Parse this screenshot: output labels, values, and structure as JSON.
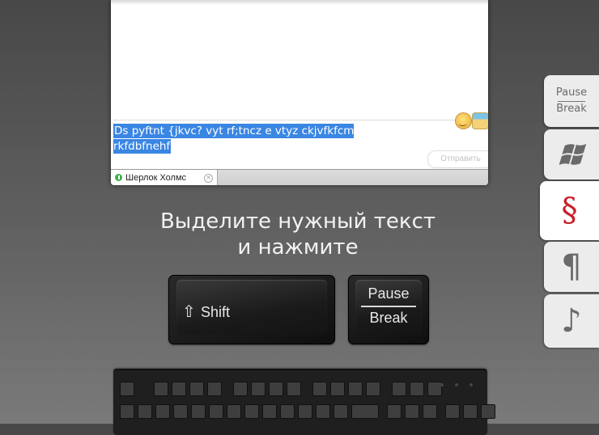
{
  "chat": {
    "message_text": "Ds pyftnt {jkvc? vyt rf;tncz e vtyz ckjvfkfcm rkfdbfnehf",
    "send_button": "Отправить",
    "emoji_icons": [
      "smiley-icon",
      "gift-icon"
    ],
    "tab": {
      "contact_name": "Шерлок  Холмс",
      "status": "online"
    }
  },
  "instruction": {
    "line1": "Выделите нужный текст",
    "line2": "и нажмите"
  },
  "keys": {
    "shift": {
      "arrow": "⇧",
      "label": "Shift"
    },
    "pause": {
      "top": "Pause",
      "bottom": "Break"
    }
  },
  "side_tabs": [
    {
      "id": "pause-break",
      "top": "Pause",
      "bottom": "Break",
      "active": false
    },
    {
      "id": "windows",
      "icon": "windows-logo-icon",
      "active": false
    },
    {
      "id": "section",
      "glyph": "§",
      "active": true,
      "color": "#c8202a"
    },
    {
      "id": "pilcrow",
      "glyph": "¶",
      "active": false
    },
    {
      "id": "music",
      "glyph": "♪",
      "active": false
    }
  ],
  "colors": {
    "selection": "#3a86e3",
    "accent_red": "#c8202a",
    "online_green": "#3db04a"
  }
}
